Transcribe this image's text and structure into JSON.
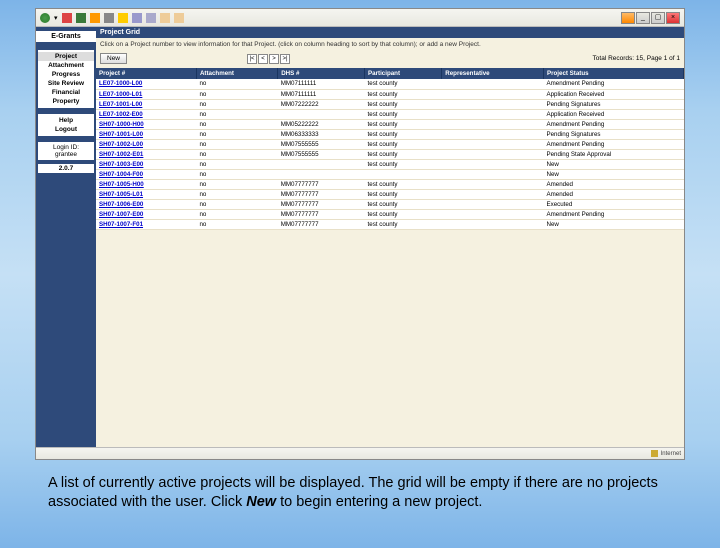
{
  "window": {
    "brand": "E-Grants",
    "grid_title": "Project Grid",
    "instruction": "Click on a Project number to view information for that Project. (click on column heading to sort by that column); or add a new Project.",
    "new_btn": "New",
    "record_count": "Total Records: 15, Page 1 of 1",
    "pager": {
      "first": "|<",
      "prev": "<",
      "next": ">",
      "last": ">|"
    },
    "status_left": "",
    "status_right": "Internet"
  },
  "sidebar": {
    "nav1": [
      {
        "label": "Project"
      },
      {
        "label": "Attachment"
      },
      {
        "label": "Progress"
      },
      {
        "label": "Site Review"
      },
      {
        "label": "Financial"
      },
      {
        "label": "Property"
      }
    ],
    "nav2": [
      {
        "label": "Help"
      },
      {
        "label": "Logout"
      }
    ],
    "login_label": "Login ID:",
    "login_id": "grantee",
    "version": "2.0.7"
  },
  "columns": [
    "Project #",
    "Attachment",
    "DHS #",
    "Participant",
    "Representative",
    "Project Status"
  ],
  "rows": [
    {
      "p": "LE07-1000-L00",
      "a": "no",
      "d": "MM07111111",
      "pt": "test county",
      "r": "",
      "s": "Amendment Pending"
    },
    {
      "p": "LE07-1000-L01",
      "a": "no",
      "d": "MM07111111",
      "pt": "test county",
      "r": "",
      "s": "Application Received"
    },
    {
      "p": "LE07-1001-L00",
      "a": "no",
      "d": "MM07222222",
      "pt": "test county",
      "r": "",
      "s": "Pending Signatures"
    },
    {
      "p": "LE07-1002-E00",
      "a": "no",
      "d": "",
      "pt": "test county",
      "r": "",
      "s": "Application Received"
    },
    {
      "p": "SH07-1000-H00",
      "a": "no",
      "d": "MM05222222",
      "pt": "test county",
      "r": "",
      "s": "Amendment Pending"
    },
    {
      "p": "SH07-1001-L00",
      "a": "no",
      "d": "MM06333333",
      "pt": "test county",
      "r": "",
      "s": "Pending Signatures"
    },
    {
      "p": "SH07-1002-L00",
      "a": "no",
      "d": "MM07555555",
      "pt": "test county",
      "r": "",
      "s": "Amendment Pending"
    },
    {
      "p": "SH07-1002-E01",
      "a": "no",
      "d": "MM07555555",
      "pt": "test county",
      "r": "",
      "s": "Pending State Approval"
    },
    {
      "p": "SH07-1003-E00",
      "a": "no",
      "d": "",
      "pt": "test county",
      "r": "",
      "s": "New"
    },
    {
      "p": "SH07-1004-F00",
      "a": "no",
      "d": "",
      "pt": "",
      "r": "",
      "s": "New"
    },
    {
      "p": "SH07-1005-H00",
      "a": "no",
      "d": "MM07777777",
      "pt": "test county",
      "r": "",
      "s": "Amended"
    },
    {
      "p": "SH07-1005-L01",
      "a": "no",
      "d": "MM07777777",
      "pt": "test county",
      "r": "",
      "s": "Amended"
    },
    {
      "p": "SH07-1006-E00",
      "a": "no",
      "d": "MM07777777",
      "pt": "test county",
      "r": "",
      "s": "Executed"
    },
    {
      "p": "SH07-1007-E00",
      "a": "no",
      "d": "MM07777777",
      "pt": "test county",
      "r": "",
      "s": "Amendment Pending"
    },
    {
      "p": "SH07-1007-F01",
      "a": "no",
      "d": "MM07777777",
      "pt": "test county",
      "r": "",
      "s": "New"
    }
  ],
  "caption": {
    "t1": "A list of currently active projects will be displayed.  The grid will be empty if there are no projects associated with the user.  Click ",
    "t2": "New",
    "t3": " to begin entering a new project."
  }
}
